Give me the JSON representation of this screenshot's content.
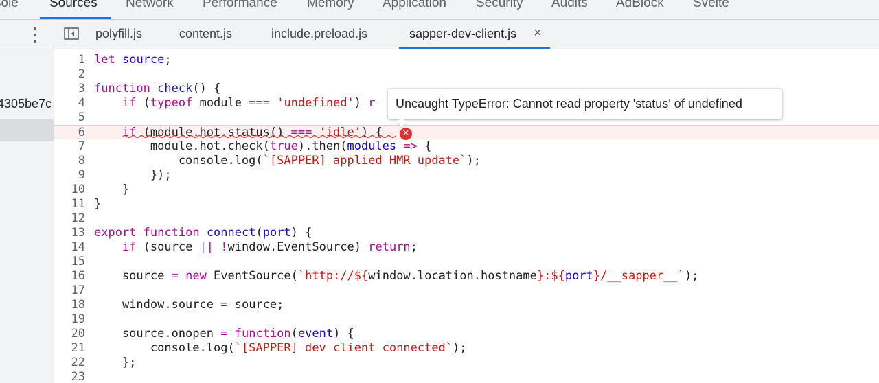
{
  "top_tabs": [
    "sole",
    "Sources",
    "Network",
    "Performance",
    "Memory",
    "Application",
    "Security",
    "Audits",
    "AdBlock",
    "Svelte"
  ],
  "active_top_tab": "Sources",
  "navigator": {
    "item": "4305be7c",
    "menu_icon": "kebab-icon"
  },
  "file_tabs": [
    "polyfill.js",
    "content.js",
    "include.preload.js",
    "sapper-dev-client.js"
  ],
  "active_file_tab": "sapper-dev-client.js",
  "close_glyph": "×",
  "error": {
    "line": 6,
    "message": "Uncaught TypeError: Cannot read property 'status' of undefined",
    "icon": "error-icon"
  },
  "colors": {
    "accent": "#1a73e8",
    "error": "#e0312b",
    "keyword": "#a90d91",
    "string": "#c41a16"
  },
  "code_lines": [
    "let source;",
    "",
    "function check() {",
    "    if (typeof module === 'undefined') r",
    "",
    "    if (module.hot.status() === 'idle') {",
    "        module.hot.check(true).then(modules => {",
    "            console.log(`[SAPPER] applied HMR update`);",
    "        });",
    "    }",
    "}",
    "",
    "export function connect(port) {",
    "    if (source || !window.EventSource) return;",
    "",
    "    source = new EventSource(`http://${window.location.hostname}:${port}/__sapper__`);",
    "",
    "    window.source = source;",
    "",
    "    source.onopen = function(event) {",
    "        console.log(`[SAPPER] dev client connected`);",
    "    };",
    ""
  ],
  "line_numbers": [
    "1",
    "2",
    "3",
    "4",
    "5",
    "6",
    "7",
    "8",
    "9",
    "10",
    "11",
    "12",
    "13",
    "14",
    "15",
    "16",
    "17",
    "18",
    "19",
    "20",
    "21",
    "22",
    "23"
  ]
}
